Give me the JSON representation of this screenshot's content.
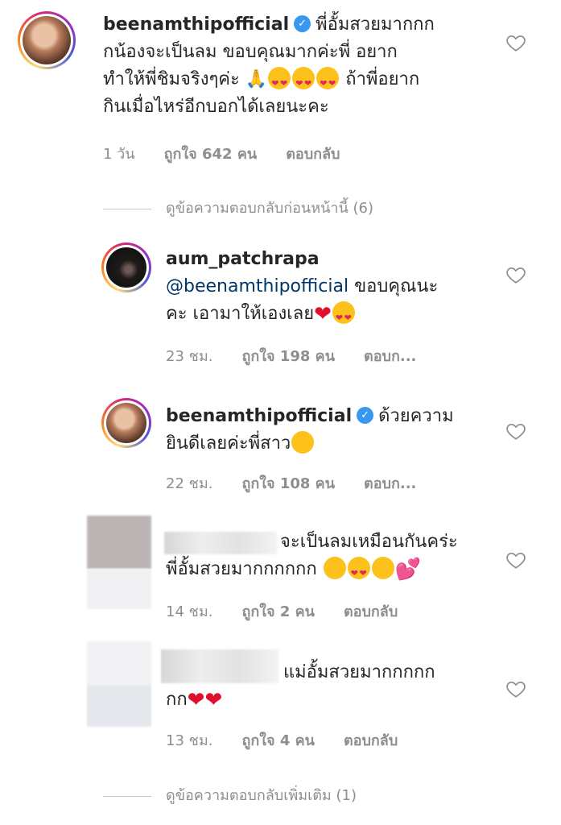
{
  "comments": [
    {
      "username": "beenamthipofficial",
      "text_line1": "พี่อั้มสวยมากกก",
      "text_line2": "กน้องจะเป็นลม ขอบคุณมากค่ะพี่ อยาก",
      "text_line3a": "ทำให้พี่ชิมจริงๆค่ะ",
      "text_line3b": "ถ้าพี่อยาก",
      "text_line4": "กินเมื่อไหร่อีกบอกได้เลยนะคะ",
      "time": "1 วัน",
      "likes": "ถูกใจ 642 คน",
      "reply": "ตอบกลับ"
    },
    {
      "username": "aum_patchrapa",
      "mention": "@beenamthipofficial",
      "text_line1": "ขอบคุณนะ",
      "text_line2": "คะ เอามาให้เองเลย",
      "time": "23 ชม.",
      "likes": "ถูกใจ 198 คน",
      "reply": "ตอบก..."
    },
    {
      "username": "beenamthipofficial",
      "text_line1": "ด้วยความ",
      "text_line2": "ยินดีเลยค่ะพี่สาว",
      "time": "22 ชม.",
      "likes": "ถูกใจ 108 คน",
      "reply": "ตอบก..."
    },
    {
      "text_line1": "จะเป็นลมเหมือนกันคร่ะ",
      "text_line2": "พี่อั้มสวยมากกกกกก",
      "time": "14 ชม.",
      "likes": "ถูกใจ 2 คน",
      "reply": "ตอบกลับ"
    },
    {
      "text_line1": "แม่อั้มสวยมากกกกก",
      "text_line2": "กก",
      "time": "13 ชม.",
      "likes": "ถูกใจ 4 คน",
      "reply": "ตอบกลับ"
    }
  ],
  "view_previous_replies": "ดูข้อความตอบกลับก่อนหน้านี้ (6)",
  "view_more_replies": "ดูข้อความตอบกลับเพิ่มเติม (1)",
  "colors": {
    "link": "#00376b",
    "meta": "#8e8e8e",
    "verified": "#3897f0"
  }
}
